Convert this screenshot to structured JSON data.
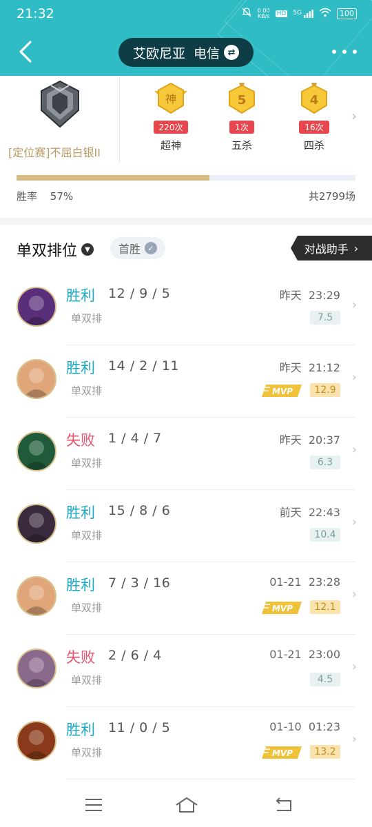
{
  "status": {
    "time": "21:32",
    "net_speed": "0.00\nKB/s",
    "hd": "HD",
    "signal": "5G",
    "battery": "100"
  },
  "header": {
    "server_label": "艾欧尼亚  电信",
    "swap_icon": "swap-icon"
  },
  "rank": {
    "label": "[定位赛]不屈白银II",
    "badges": [
      {
        "glyph": "神",
        "count": "220次",
        "name": "超神"
      },
      {
        "glyph": "5",
        "count": "1次",
        "name": "五杀"
      },
      {
        "glyph": "4",
        "count": "16次",
        "name": "四杀"
      }
    ],
    "win_rate_label": "胜率",
    "win_rate": "57%",
    "win_rate_value": 0.57,
    "total": "共2799场"
  },
  "section": {
    "title": "单双排位",
    "first_win": "首胜",
    "assistant": "对战助手"
  },
  "matches": [
    {
      "result": "胜利",
      "outcome": "win",
      "kda": "12 / 9 / 5",
      "mode": "单双排",
      "time": "昨天  23:29",
      "score": "7.5",
      "mvp": false,
      "avatar_color": "#5a2f7a"
    },
    {
      "result": "胜利",
      "outcome": "win",
      "kda": "14 / 2 / 11",
      "mode": "单双排",
      "time": "昨天  21:12",
      "score": "12.9",
      "mvp": true,
      "avatar_color": "#e0a67a"
    },
    {
      "result": "失败",
      "outcome": "loss",
      "kda": "1 / 4 / 7",
      "mode": "单双排",
      "time": "昨天  20:37",
      "score": "6.3",
      "mvp": false,
      "avatar_color": "#1f5b3a"
    },
    {
      "result": "胜利",
      "outcome": "win",
      "kda": "15 / 8 / 6",
      "mode": "单双排",
      "time": "前天  22:43",
      "score": "10.4",
      "mvp": false,
      "avatar_color": "#3a2a3e"
    },
    {
      "result": "胜利",
      "outcome": "win",
      "kda": "7 / 3 / 16",
      "mode": "单双排",
      "time": "01-21  23:28",
      "score": "12.1",
      "mvp": true,
      "avatar_color": "#e0a67a"
    },
    {
      "result": "失败",
      "outcome": "loss",
      "kda": "2 / 6 / 4",
      "mode": "单双排",
      "time": "01-21  23:00",
      "score": "4.5",
      "mvp": false,
      "avatar_color": "#8a6a8c"
    },
    {
      "result": "胜利",
      "outcome": "win",
      "kda": "11 / 0 / 5",
      "mode": "单双排",
      "time": "01-10  01:23",
      "score": "13.2",
      "mvp": true,
      "avatar_color": "#8a3a1a"
    }
  ],
  "mvp_text": "MVP",
  "colors": {
    "header_teal": "#2fbcc4",
    "win": "#19a9c2",
    "loss": "#e9516a",
    "gold": "#d6bb84"
  }
}
